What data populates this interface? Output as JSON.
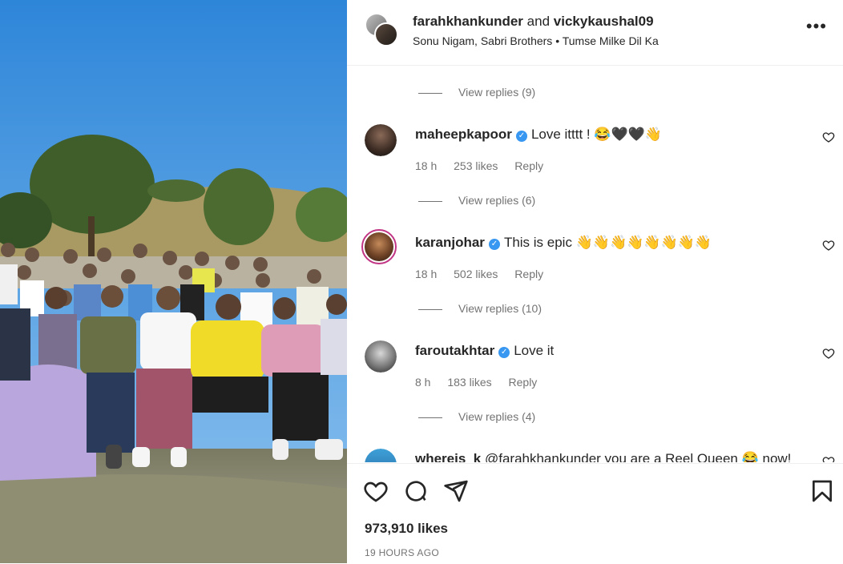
{
  "header": {
    "user1": "farahkhankunder",
    "joiner": "and",
    "user2": "vickykaushal09",
    "audio": "Sonu Nigam, Sabri Brothers • Tumse Milke Dil Ka",
    "more_icon": "more-horizontal-icon"
  },
  "comments": {
    "replies_top": "View replies (9)",
    "items": [
      {
        "user": "maheepkapoor",
        "text": "Love itttt ! 😂🖤🖤👋",
        "time": "18 h",
        "likes": "253 likes",
        "reply": "Reply",
        "replies": "View replies (6)"
      },
      {
        "user": "karanjohar",
        "text": "This is epic 👋👋👋👋👋👋👋👋",
        "time": "18 h",
        "likes": "502 likes",
        "reply": "Reply",
        "replies": "View replies (10)"
      },
      {
        "user": "faroutakhtar",
        "text": "Love it",
        "time": "8 h",
        "likes": "183 likes",
        "reply": "Reply",
        "replies": "View replies (4)"
      },
      {
        "user": "whereis_k",
        "text": "@farahkhankunder you are a Reel Queen 😂 now!"
      }
    ]
  },
  "actions": {
    "likes": "973,910 likes",
    "time_ago": "19 HOURS AGO",
    "icons": [
      "heart-icon",
      "comment-icon",
      "share-icon",
      "bookmark-icon"
    ]
  }
}
